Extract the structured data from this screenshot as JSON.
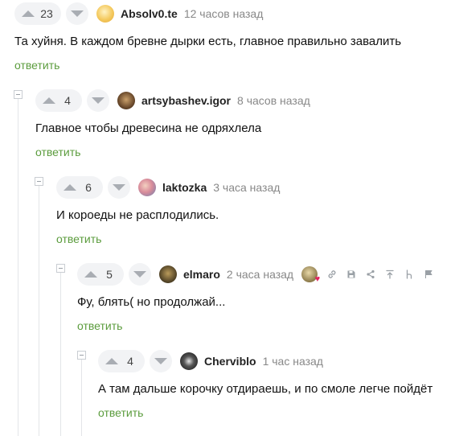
{
  "colors": {
    "reply": "#5b9c3d",
    "vote_bg": "#f2f3f5",
    "meta": "#888888"
  },
  "comments": [
    {
      "score": "23",
      "author": "Absolv0.te",
      "time": "12 часов назад",
      "text": "Та хуйня. В каждом бревне дырки есть, главное правильно завалить",
      "reply": "ответить"
    },
    {
      "score": "4",
      "author": "artsybashev.igor",
      "time": "8 часов назад",
      "text": "Главное чтобы древесина не одряхлела",
      "reply": "ответить"
    },
    {
      "score": "6",
      "author": "laktozka",
      "time": "3 часа назад",
      "text": "И короеды не расплодились.",
      "reply": "ответить"
    },
    {
      "score": "5",
      "author": "elmaro",
      "time": "2 часа назад",
      "text": "Фу, блять( но продолжай...",
      "reply": "ответить",
      "tools": [
        "award-icon",
        "link-icon",
        "save-icon",
        "share-icon",
        "pin-up-icon",
        "branch-icon",
        "flag-icon"
      ]
    },
    {
      "score": "4",
      "author": "Cherviblo",
      "time": "1 час назад",
      "text": "А там дальше корочку отдираешь, и по смоле легче пойдёт",
      "reply": "ответить"
    }
  ]
}
